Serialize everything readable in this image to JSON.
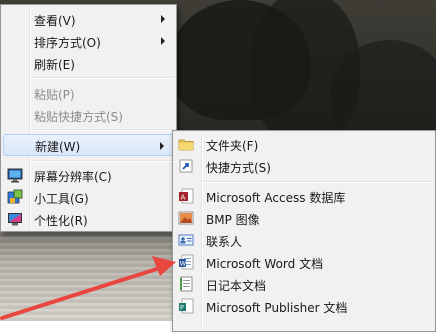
{
  "context_menu": {
    "items": [
      {
        "label": "查看(V)",
        "has_submenu": true
      },
      {
        "label": "排序方式(O)",
        "has_submenu": true
      },
      {
        "label": "刷新(E)"
      },
      {
        "label": "粘贴(P)",
        "disabled": true
      },
      {
        "label": "粘贴快捷方式(S)",
        "disabled": true
      },
      {
        "label": "新建(W)",
        "has_submenu": true,
        "highlighted": true
      },
      {
        "label": "屏幕分辨率(C)",
        "icon": "screen-resolution-icon"
      },
      {
        "label": "小工具(G)",
        "icon": "gadgets-icon"
      },
      {
        "label": "个性化(R)",
        "icon": "personalize-icon"
      }
    ]
  },
  "new_submenu": {
    "items": [
      {
        "label": "文件夹(F)",
        "icon": "folder-icon"
      },
      {
        "label": "快捷方式(S)",
        "icon": "shortcut-icon"
      },
      {
        "label": "Microsoft Access 数据库",
        "icon": "access-icon"
      },
      {
        "label": "BMP 图像",
        "icon": "bmp-image-icon"
      },
      {
        "label": "联系人",
        "icon": "contact-icon"
      },
      {
        "label": "Microsoft Word 文档",
        "icon": "word-icon"
      },
      {
        "label": "日记本文档",
        "icon": "journal-icon"
      },
      {
        "label": "Microsoft Publisher 文档",
        "icon": "publisher-icon"
      }
    ]
  },
  "colors": {
    "highlight": "#d9e7f9",
    "annotation_arrow": "#e8463f"
  }
}
